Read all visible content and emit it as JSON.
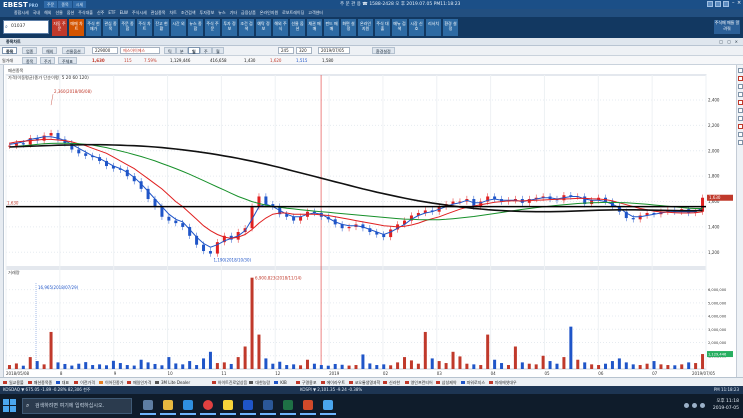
{
  "app": {
    "logo": "EBEST",
    "logo_sub": "PRO",
    "title_tabs": [
      "주문",
      "종목",
      "시세"
    ],
    "title_info": "주 문   관 용  ☎ 1588-2428   오 후   2019.07.05   PM11:18:23",
    "menu_items": [
      "종합시세",
      "국내",
      "해외",
      "선물",
      "옵션",
      "주식대출",
      "신주",
      "ETF",
      "ELW",
      "주식시세",
      "관심종목",
      "차트",
      "조건검색",
      "투자정보",
      "뉴스",
      "기타",
      "금융상품",
      "온라인지원",
      "로보트레이딩",
      "고객센터"
    ]
  },
  "toolbar": {
    "search_value": "01037",
    "buttons": [
      {
        "label": "자동 주문",
        "color": "#c0392b"
      },
      {
        "label": "매매 차트",
        "color": "#d35400"
      },
      {
        "label": "주식 현재가",
        "color": "#2d6aa3"
      },
      {
        "label": "관심 종목",
        "color": "#2d6aa3"
      },
      {
        "label": "주문 종합",
        "color": "#2d6aa3"
      },
      {
        "label": "주식 차트",
        "color": "#2d6aa3"
      },
      {
        "label": "잔고 현황",
        "color": "#2d6aa3"
      },
      {
        "label": "시간 외",
        "color": "#2d6aa3"
      },
      {
        "label": "뉴스 종합",
        "color": "#2d6aa3"
      },
      {
        "label": "주식 주문",
        "color": "#2d6aa3"
      },
      {
        "label": "투자 정보",
        "color": "#2d6aa3"
      },
      {
        "label": "조건 검색",
        "color": "#2d6aa3"
      },
      {
        "label": "예탁 정보",
        "color": "#2d6aa3"
      },
      {
        "label": "해외 주식",
        "color": "#2d6aa3"
      },
      {
        "label": "선물 옵션",
        "color": "#2d6aa3"
      },
      {
        "label": "채권 매매",
        "color": "#2d6aa3"
      },
      {
        "label": "펀드 매매",
        "color": "#2d6aa3"
      },
      {
        "label": "화면 설정",
        "color": "#2d6aa3"
      },
      {
        "label": "온라인 지원",
        "color": "#2d6aa3"
      },
      {
        "label": "주식 대출",
        "color": "#2d6aa3"
      },
      {
        "label": "메뉴 검색",
        "color": "#2d6aa3"
      },
      {
        "label": "시장 신호",
        "color": "#2d6aa3"
      },
      {
        "label": "리서치",
        "color": "#2d6aa3"
      },
      {
        "label": "환경 설정",
        "color": "#2d6aa3"
      }
    ],
    "right_button": "주식매 매들 알려줘"
  },
  "screenbar": {
    "items": [
      "종목차트",
      "□",
      "▢",
      "×"
    ]
  },
  "chartctl": {
    "tabs": [
      "종목",
      "업종",
      "해외",
      "선물옵션"
    ],
    "code": "229000",
    "name": "에스아이에스",
    "timeframes": [
      "틱",
      "분",
      "일",
      "주",
      "월"
    ],
    "count": "245",
    "count2": "320",
    "date": "2019/07/05",
    "right_btn": "환경설정",
    "row3": [
      "일거래",
      "종목",
      "주기",
      "주체표"
    ],
    "price": "1,630",
    "change": "115",
    "change_rate": "7.59%",
    "volume": "1,129,446",
    "amount": "416,658",
    "open": "1,430",
    "high": "1,620",
    "low": "1,515",
    "extra": "1,580"
  },
  "chart_data": {
    "type": "line",
    "title": "가격(이동평균(종가 단순이평) 5 20 60 120)",
    "subtitle": "패션종목",
    "price_axis": {
      "ylim": [
        1100,
        2550
      ],
      "ticks": [
        "2,400",
        "2,200",
        "2,000",
        "1,800",
        "1,600",
        "1,400",
        "1,200"
      ],
      "current_label": "1,630",
      "left_label": "1,630"
    },
    "x_ticks": [
      "2018/05/08",
      "8",
      "9",
      "10",
      "11",
      "12",
      "2019",
      "02",
      "03",
      "04",
      "05",
      "06",
      "07",
      "2019/07/05"
    ],
    "annotations": {
      "max_label": "2,360(2018/06/08)",
      "min_label": "1,190(2018/10/30)",
      "vol_max_label": "6,900,823(2018/11/14)",
      "vol_left_label": "16,965(2018/07/29)"
    },
    "close_series": [
      2040,
      2060,
      2050,
      2100,
      2080,
      2120,
      2140,
      2090,
      2060,
      2010,
      1980,
      1960,
      1950,
      1920,
      1880,
      1860,
      1850,
      1800,
      1760,
      1700,
      1620,
      1560,
      1480,
      1450,
      1430,
      1400,
      1330,
      1260,
      1210,
      1190,
      1280,
      1330,
      1300,
      1360,
      1390,
      1560,
      1640,
      1580,
      1560,
      1500,
      1480,
      1450,
      1480,
      1520,
      1510,
      1480,
      1460,
      1420,
      1390,
      1400,
      1420,
      1390,
      1360,
      1340,
      1320,
      1380,
      1420,
      1450,
      1490,
      1510,
      1530,
      1520,
      1560,
      1580,
      1600,
      1600,
      1620,
      1560,
      1600,
      1640,
      1620,
      1600,
      1610,
      1620,
      1590,
      1620,
      1630,
      1640,
      1620,
      1610,
      1650,
      1640,
      1640,
      1580,
      1610,
      1630,
      1600,
      1560,
      1520,
      1470,
      1460,
      1490,
      1510,
      1500,
      1520,
      1530,
      1520,
      1540,
      1510,
      1520,
      1630
    ],
    "ma_series": [
      {
        "name": "5",
        "color": "#1f55c8",
        "values": [
          2050,
          2060,
          2070,
          2090,
          2100,
          2110,
          2110,
          2100,
          2080,
          2050,
          2020,
          1990,
          1960,
          1940,
          1910,
          1880,
          1860,
          1830,
          1790,
          1740,
          1680,
          1620,
          1560,
          1500,
          1460,
          1440,
          1380,
          1320,
          1270,
          1240,
          1260,
          1290,
          1310,
          1330,
          1370,
          1460,
          1560,
          1580,
          1560,
          1530,
          1500,
          1480,
          1480,
          1500,
          1510,
          1500,
          1470,
          1440,
          1420,
          1410,
          1410,
          1400,
          1380,
          1360,
          1340,
          1360,
          1390,
          1420,
          1460,
          1490,
          1510,
          1520,
          1540,
          1560,
          1580,
          1590,
          1610,
          1590,
          1590,
          1610,
          1620,
          1610,
          1610,
          1610,
          1600,
          1610,
          1620,
          1630,
          1630,
          1620,
          1630,
          1640,
          1640,
          1620,
          1610,
          1610,
          1600,
          1580,
          1550,
          1510,
          1480,
          1480,
          1490,
          1500,
          1510,
          1520,
          1520,
          1520,
          1520,
          1520,
          1550
        ]
      },
      {
        "name": "20",
        "color": "#e02020",
        "values": [
          2060,
          2070,
          2075,
          2080,
          2085,
          2090,
          2090,
          2085,
          2080,
          2070,
          2055,
          2040,
          2020,
          2000,
          1980,
          1950,
          1920,
          1890,
          1860,
          1820,
          1780,
          1740,
          1700,
          1650,
          1600,
          1560,
          1510,
          1460,
          1410,
          1370,
          1340,
          1320,
          1310,
          1320,
          1340,
          1380,
          1430,
          1470,
          1500,
          1510,
          1510,
          1500,
          1500,
          1500,
          1500,
          1495,
          1490,
          1480,
          1470,
          1460,
          1450,
          1440,
          1430,
          1420,
          1410,
          1405,
          1400,
          1405,
          1415,
          1430,
          1450,
          1465,
          1480,
          1500,
          1520,
          1540,
          1555,
          1565,
          1575,
          1585,
          1595,
          1600,
          1605,
          1605,
          1605,
          1608,
          1610,
          1612,
          1615,
          1618,
          1620,
          1622,
          1625,
          1625,
          1622,
          1620,
          1615,
          1605,
          1590,
          1575,
          1560,
          1545,
          1535,
          1525,
          1518,
          1515,
          1512,
          1510,
          1510,
          1512,
          1520
        ]
      },
      {
        "name": "60",
        "color": "#17902a",
        "values": [
          2030,
          2035,
          2040,
          2045,
          2050,
          2055,
          2058,
          2060,
          2060,
          2058,
          2055,
          2050,
          2045,
          2035,
          2025,
          2012,
          1998,
          1985,
          1970,
          1955,
          1938,
          1920,
          1900,
          1880,
          1860,
          1838,
          1815,
          1790,
          1765,
          1740,
          1715,
          1690,
          1665,
          1640,
          1620,
          1600,
          1585,
          1572,
          1562,
          1555,
          1548,
          1542,
          1536,
          1530,
          1525,
          1520,
          1515,
          1510,
          1505,
          1500,
          1495,
          1490,
          1485,
          1480,
          1475,
          1470,
          1466,
          1462,
          1460,
          1458,
          1457,
          1456,
          1457,
          1460,
          1465,
          1470,
          1476,
          1482,
          1490,
          1498,
          1506,
          1514,
          1522,
          1530,
          1538,
          1545,
          1552,
          1558,
          1564,
          1570,
          1575,
          1580,
          1585,
          1588,
          1590,
          1592,
          1593,
          1593,
          1592,
          1590,
          1587,
          1583,
          1578,
          1573,
          1568,
          1563,
          1558,
          1553,
          1548,
          1545,
          1545
        ]
      },
      {
        "name": "120",
        "color": "#111111",
        "values": [
          2030,
          2032,
          2034,
          2036,
          2038,
          2040,
          2042,
          2044,
          2045,
          2046,
          2047,
          2048,
          2048,
          2048,
          2047,
          2046,
          2044,
          2042,
          2040,
          2037,
          2034,
          2030,
          2025,
          2020,
          2014,
          2008,
          2001,
          1994,
          1986,
          1978,
          1969,
          1960,
          1950,
          1940,
          1929,
          1918,
          1906,
          1894,
          1881,
          1868,
          1854,
          1840,
          1826,
          1812,
          1798,
          1784,
          1770,
          1756,
          1742,
          1728,
          1714,
          1700,
          1687,
          1674,
          1662,
          1650,
          1638,
          1627,
          1616,
          1606,
          1597,
          1588,
          1580,
          1572,
          1565,
          1558,
          1552,
          1546,
          1541,
          1536,
          1532,
          1529,
          1526,
          1524,
          1522,
          1521,
          1520,
          1520,
          1520,
          1521,
          1522,
          1524,
          1526,
          1528,
          1530,
          1532,
          1533,
          1534,
          1535,
          1535,
          1535,
          1534,
          1533,
          1532,
          1531,
          1530,
          1529,
          1528,
          1528,
          1528,
          1530
        ]
      }
    ],
    "volume": {
      "ticks": [
        "6,000,000",
        "5,000,000",
        "4,000,000",
        "3,000,000",
        "2,000,000",
        "1,000,000"
      ],
      "ylim": [
        0,
        6800000
      ],
      "current_label": "1,129,446",
      "values": [
        300000,
        420000,
        250000,
        900000,
        600000,
        350000,
        2800000,
        500000,
        380000,
        260000,
        400000,
        520000,
        300000,
        350000,
        280000,
        620000,
        450000,
        300000,
        260000,
        700000,
        500000,
        380000,
        280000,
        900000,
        420000,
        350000,
        600000,
        300000,
        800000,
        1300000,
        450000,
        500000,
        380000,
        900000,
        1700000,
        6900000,
        2600000,
        800000,
        400000,
        550000,
        300000,
        350000,
        280000,
        700000,
        400000,
        300000,
        250000,
        380000,
        320000,
        260000,
        300000,
        1100000,
        420000,
        300000,
        350000,
        280000,
        500000,
        900000,
        650000,
        400000,
        2800000,
        800000,
        600000,
        450000,
        1300000,
        950000,
        400000,
        350000,
        300000,
        2600000,
        700000,
        450000,
        300000,
        1700000,
        500000,
        400000,
        350000,
        1000000,
        600000,
        400000,
        900000,
        3200000,
        700000,
        500000,
        350000,
        300000,
        400000,
        600000,
        800000,
        500000,
        350000,
        300000,
        400000,
        600000,
        350000,
        300000,
        280000,
        350000,
        500000,
        450000,
        1129446
      ]
    }
  },
  "legend": {
    "items": [
      {
        "label": "일교용볼",
        "color": "#c0392b"
      },
      {
        "label": "패션종목종",
        "color": "#c0392b"
      },
      {
        "label": "대표",
        "color": "#1f55c8"
      },
      {
        "label": "이전가격",
        "color": "#c0392b"
      },
      {
        "label": "이어진종가",
        "color": "#e67e22"
      },
      {
        "label": "매일인가격",
        "color": "#c0392b"
      },
      {
        "label": "3M Lite Dealer",
        "color": "#555555"
      },
      {
        "label": "하이트진로없상음",
        "color": "#c0392b"
      },
      {
        "label": "대한농람",
        "color": "#555555"
      },
      {
        "label": "KIB",
        "color": "#1f55c8"
      },
      {
        "label": "구명용포",
        "color": "#c0392b"
      },
      {
        "label": "에이라우트",
        "color": "#c0392b"
      },
      {
        "label": "코오롱생명과학",
        "color": "#c0392b"
      },
      {
        "label": "신라한",
        "color": "#c0392b"
      },
      {
        "label": "영인프런티어",
        "color": "#c0392b"
      },
      {
        "label": "삼성제약",
        "color": "#c0392b"
      },
      {
        "label": "파워로지스",
        "color": "#1f55c8"
      },
      {
        "label": "미래에셋대우",
        "color": "#c0392b"
      }
    ]
  },
  "ticker": {
    "left": "KOSDAQ   ▼ 675.05   -1.89   -0.28%   82,306 천주",
    "mid": "KOSPI   ▼ 2,101.35   -9.24   -0.38%",
    "right": "PM 11:18:23"
  },
  "taskbar": {
    "search_placeholder": "검색하려면 여기에 입력하십시오.",
    "time": "오후 11:18",
    "date": "2019-07-05"
  }
}
